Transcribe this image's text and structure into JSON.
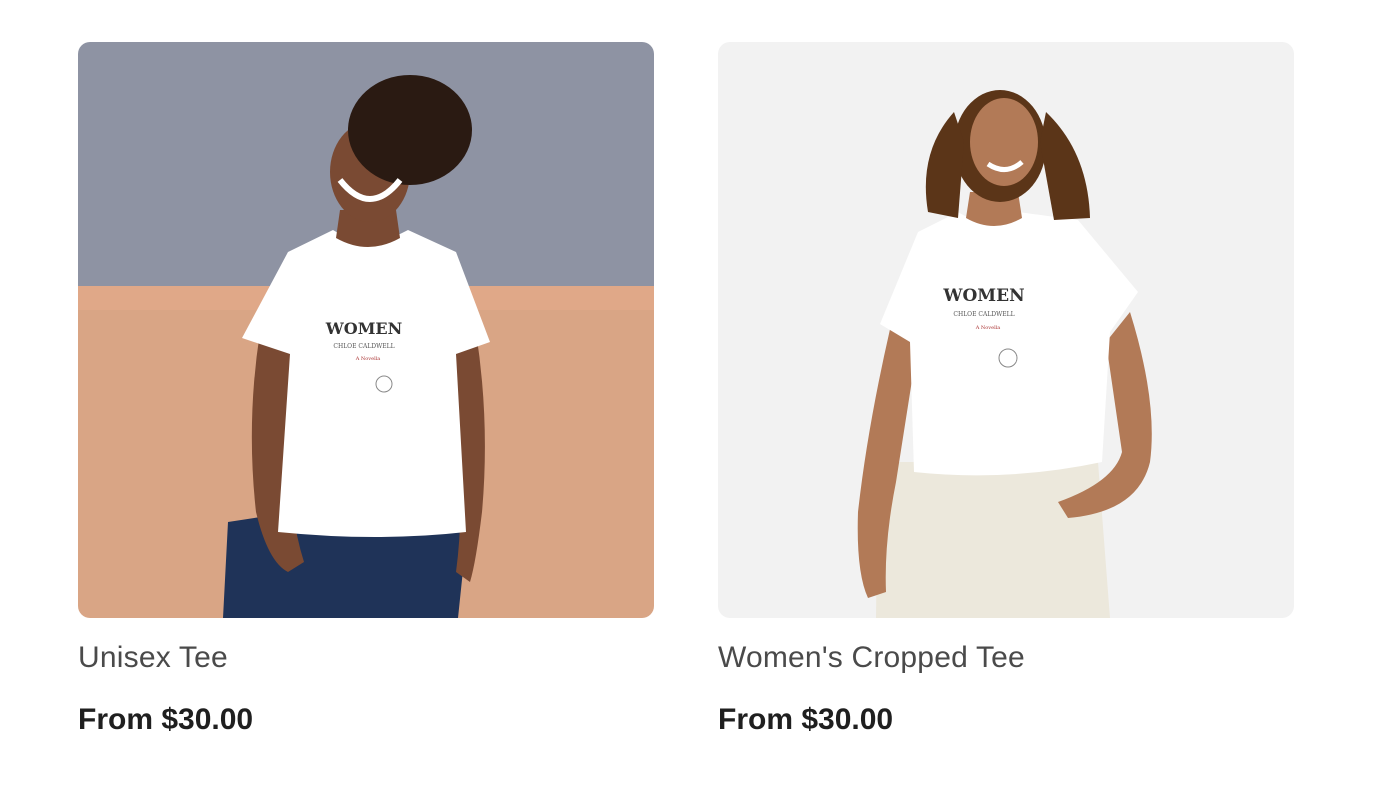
{
  "products": [
    {
      "title": "Unisex Tee",
      "price": "From $30.00",
      "image_alt": "Woman wearing a white unisex tee",
      "shirt_print": {
        "headline": "WOMEN",
        "author": "CHLOE CALDWELL",
        "subtitle": "A Novella"
      },
      "colors": {
        "wall_top": "#8e93a3",
        "wall_bottom": "#d9a585",
        "shirt": "#ffffff",
        "jeans": "#1f3358",
        "hair": "#2a1a12",
        "skin": "#7a4a33"
      }
    },
    {
      "title": "Women's Cropped Tee",
      "price": "From $30.00",
      "image_alt": "Woman wearing a white cropped tee",
      "shirt_print": {
        "headline": "WOMEN",
        "author": "CHLOE CALDWELL",
        "subtitle": "A Novella"
      },
      "colors": {
        "background": "#f2f2f2",
        "shirt": "#ffffff",
        "pants": "#ece8dc",
        "hair": "#5b3518",
        "skin": "#b27a57"
      }
    }
  ]
}
